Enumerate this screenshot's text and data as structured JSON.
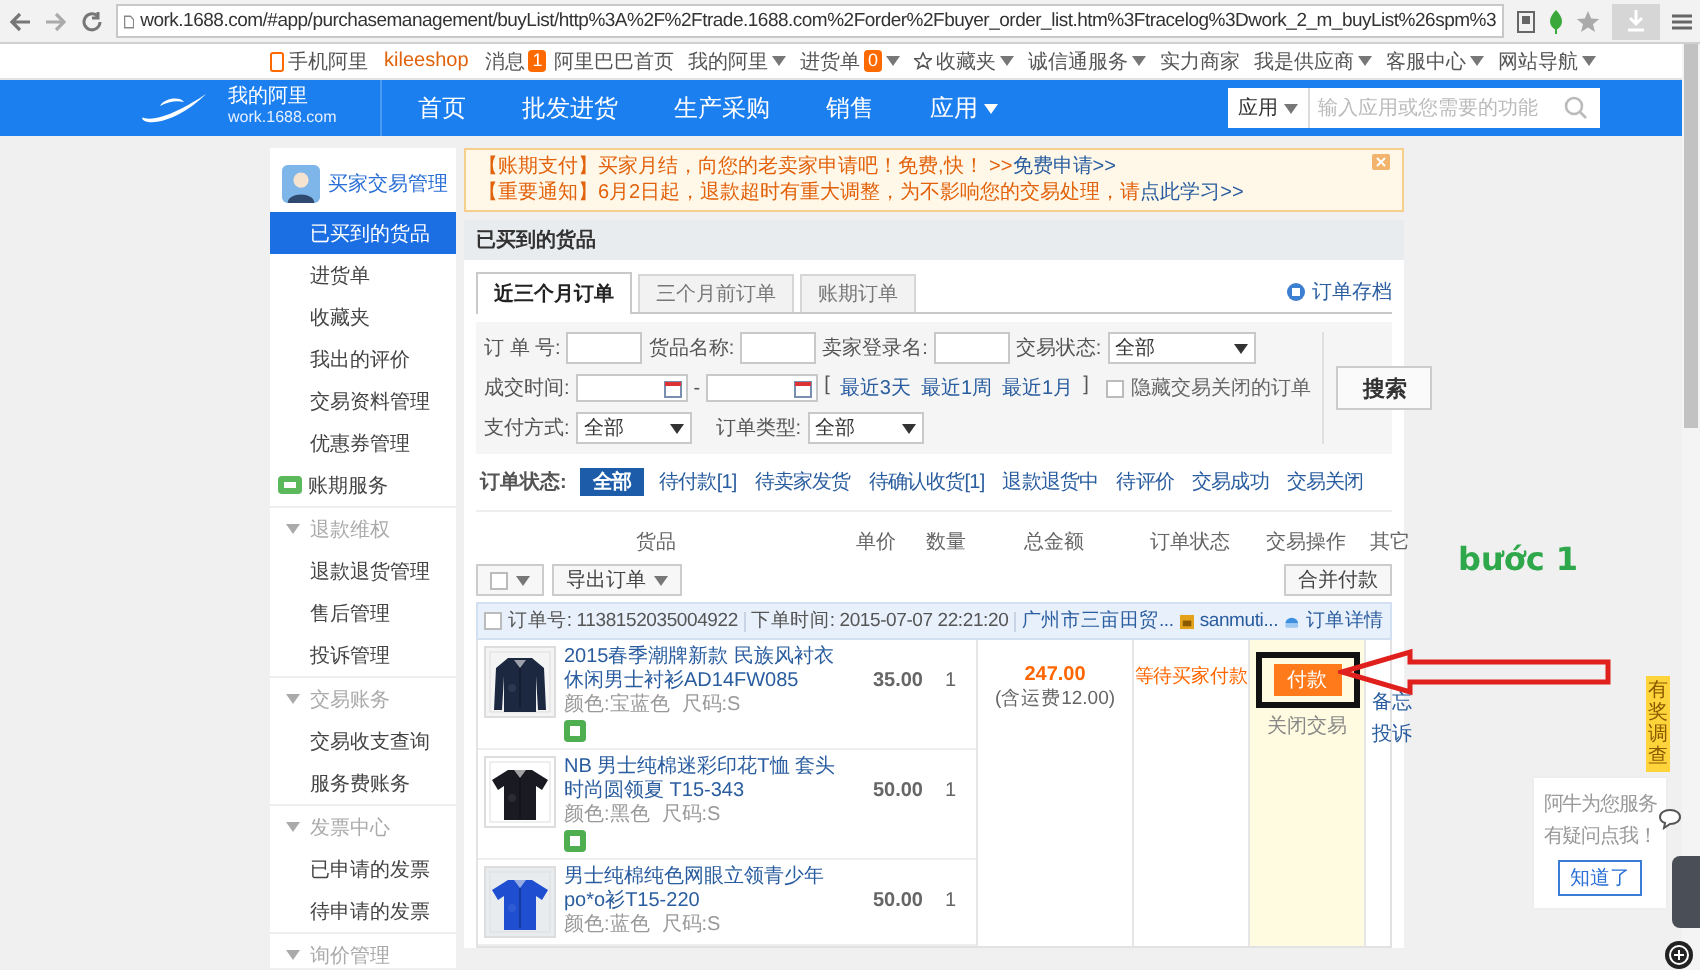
{
  "browser": {
    "url": "work.1688.com/#app/purchasemanagement/buyList/http%3A%2F%2Ftrade.1688.com%2Forder%2Fbuyer_order_list.htm%3Ftracelog%3Dwork_2_m_buyList%26spm%3"
  },
  "top_links": {
    "left": [
      {
        "kind": "mobile",
        "label": "手机阿里"
      },
      {
        "kind": "user",
        "label": "kileeshop"
      },
      {
        "kind": "messages",
        "label": "消息",
        "badge": "1"
      }
    ],
    "right": [
      {
        "kind": "plain",
        "label": "阿里巴巴首页"
      },
      {
        "kind": "menu",
        "label": "我的阿里"
      },
      {
        "kind": "badge_menu",
        "label": "进货单",
        "badge": "0"
      },
      {
        "kind": "star_menu",
        "label": "收藏夹"
      },
      {
        "kind": "menu",
        "label": "诚信通服务"
      },
      {
        "kind": "plain",
        "label": "实力商家"
      },
      {
        "kind": "menu",
        "label": "我是供应商"
      },
      {
        "kind": "menu",
        "label": "客服中心"
      },
      {
        "kind": "menu",
        "label": "网站导航"
      }
    ]
  },
  "header": {
    "logo_title": "我的阿里",
    "logo_subtitle": "work.1688.com",
    "nav": [
      {
        "label": "首页",
        "dropdown": false
      },
      {
        "label": "批发进货",
        "dropdown": false
      },
      {
        "label": "生产采购",
        "dropdown": false
      },
      {
        "label": "销售",
        "dropdown": false
      },
      {
        "label": "应用",
        "dropdown": true
      }
    ],
    "search": {
      "scope": "应用",
      "placeholder": "输入应用或您需要的功能"
    }
  },
  "sidebar": {
    "title": "买家交易管理",
    "items": [
      {
        "label": "已买到的货品",
        "selected": true,
        "kind": "plain"
      },
      {
        "label": "进货单",
        "selected": false,
        "kind": "plain"
      },
      {
        "label": "收藏夹",
        "selected": false,
        "kind": "plain"
      },
      {
        "label": "我出的评价",
        "selected": false,
        "kind": "plain"
      },
      {
        "label": "交易资料管理",
        "selected": false,
        "kind": "plain"
      },
      {
        "label": "优惠券管理",
        "selected": false,
        "kind": "plain"
      },
      {
        "label": "账期服务",
        "selected": false,
        "kind": "badge"
      }
    ],
    "groups": [
      {
        "title": "退款维权",
        "items": [
          {
            "label": "退款退货管理",
            "selected": false
          },
          {
            "label": "售后管理",
            "selected": false
          },
          {
            "label": "投诉管理",
            "selected": false
          }
        ]
      },
      {
        "title": "交易账务",
        "items": [
          {
            "label": "交易收支查询",
            "selected": false
          },
          {
            "label": "服务费账务",
            "selected": false
          }
        ]
      },
      {
        "title": "发票中心",
        "items": [
          {
            "label": "已申请的发票",
            "selected": false
          },
          {
            "label": "待申请的发票",
            "selected": false
          }
        ]
      },
      {
        "title": "询价管理"
      }
    ]
  },
  "notice": {
    "lines": [
      {
        "text": "【账期支付】买家月结，向您的老卖家申请吧！免费,快！ >>",
        "link": "免费申请>>"
      },
      {
        "text": "【重要通知】6月2日起，退款超时有重大调整，为不影响您的交易处理，请",
        "link": "点此学习>>"
      }
    ]
  },
  "page_title": "已买到的货品",
  "tabs": [
    {
      "label": "近三个月订单",
      "selected": true
    },
    {
      "label": "三个月前订单",
      "selected": false
    },
    {
      "label": "账期订单",
      "selected": false
    }
  ],
  "archive_link": "订单存档",
  "filters": {
    "order_number": {
      "label": "订 单 号:"
    },
    "product_name": {
      "label": "货品名称:"
    },
    "seller": {
      "label": "卖家登录名:"
    },
    "trade_status": {
      "label": "交易状态:",
      "value": "全部"
    },
    "deal_time": {
      "label": "成交时间:",
      "separator": "-"
    },
    "quick_ranges": {
      "open": "[",
      "links": [
        "最近3天",
        "最近1周",
        "最近1月"
      ],
      "close": "]"
    },
    "hide_closed": {
      "label": "隐藏交易关闭的订单",
      "checked": false
    },
    "payment": {
      "label": "支付方式:",
      "value": "全部"
    },
    "order_type": {
      "label": "订单类型:",
      "value": "全部"
    },
    "search_button": "搜索"
  },
  "status_filter": {
    "label": "订单状态:",
    "options": [
      {
        "label": "全部",
        "selected": true
      },
      {
        "label": "待付款[1]",
        "selected": false
      },
      {
        "label": "待卖家发货",
        "selected": false
      },
      {
        "label": "待确认收货[1]",
        "selected": false
      },
      {
        "label": "退款退货中",
        "selected": false
      },
      {
        "label": "待评价",
        "selected": false
      },
      {
        "label": "交易成功",
        "selected": false
      },
      {
        "label": "交易关闭",
        "selected": false
      }
    ]
  },
  "table": {
    "select_all_checked": false,
    "columns": [
      "货品",
      "单价",
      "数量",
      "总金额",
      "订单状态",
      "交易操作",
      "其它"
    ],
    "export_button": "导出订单",
    "merge_pay_button": "合并付款"
  },
  "order": {
    "checked": false,
    "number_label": "订单号:",
    "number": "1138152035004922",
    "time_label": "下单时间:",
    "time": "2015-07-07 22:21:20",
    "seller_company": "广州市三亩田贸...",
    "seller_id": "sanmuti...",
    "detail_link": "订单详情",
    "items": [
      {
        "title": "2015春季潮牌新款 民族风衬衣休闲男士衬衫AD14FW085",
        "price": "35.00",
        "quantity": "1",
        "variant": "颜色:宝蓝色",
        "size": "尺码:S",
        "badge": true
      },
      {
        "title": "NB 男士纯棉迷彩印花T恤 套头时尚圆领夏 T15-343",
        "price": "50.00",
        "quantity": "1",
        "variant": "颜色:黑色",
        "size": "尺码:S",
        "badge": true
      },
      {
        "title": "男士纯棉纯色网眼立领青少年po*o衫T15-220",
        "price": "50.00",
        "quantity": "1",
        "variant": "颜色:蓝色",
        "size": "尺码:S",
        "badge": false
      }
    ],
    "total": "247.00",
    "shipping": "(含运费12.00)",
    "status": "等待买家付款",
    "pay_button": "付款",
    "close_link": "关闭交易",
    "other_links": [
      "备忘",
      "投诉"
    ]
  },
  "annotation": {
    "step": "bước 1"
  },
  "side_widgets": {
    "survey_tab": "有奖调查",
    "helper": {
      "lines": [
        "阿牛为您服务",
        "有疑问点我！"
      ],
      "button": "知道了"
    }
  }
}
